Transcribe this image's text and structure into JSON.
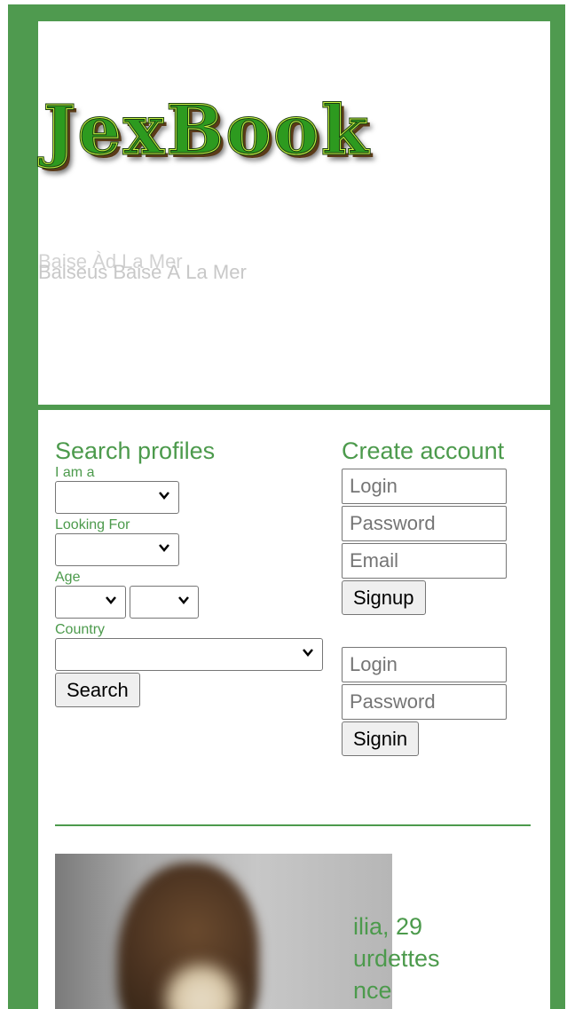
{
  "header": {
    "logo_text": "JexBook",
    "tagline_primary": "Baiseus Baise À La Mer",
    "tagline_secondary": "Baise Àd La Mer"
  },
  "search": {
    "heading": "Search profiles",
    "i_am_label": "I am a",
    "looking_for_label": "Looking For",
    "age_label": "Age",
    "country_label": "Country",
    "search_button": "Search"
  },
  "create_account": {
    "heading": "Create account",
    "login_placeholder": "Login",
    "password_placeholder": "Password",
    "email_placeholder": "Email",
    "signup_button": "Signup"
  },
  "signin": {
    "login_placeholder": "Login",
    "password_placeholder": "Password",
    "signin_button": "Signin"
  },
  "profile": {
    "name_age": "ilia, 29",
    "city": "urdettes",
    "country": "nce"
  },
  "colors": {
    "accent": "#4c9a4c",
    "frame": "#4f9a4f",
    "logo_green": "#2d9a1f"
  }
}
